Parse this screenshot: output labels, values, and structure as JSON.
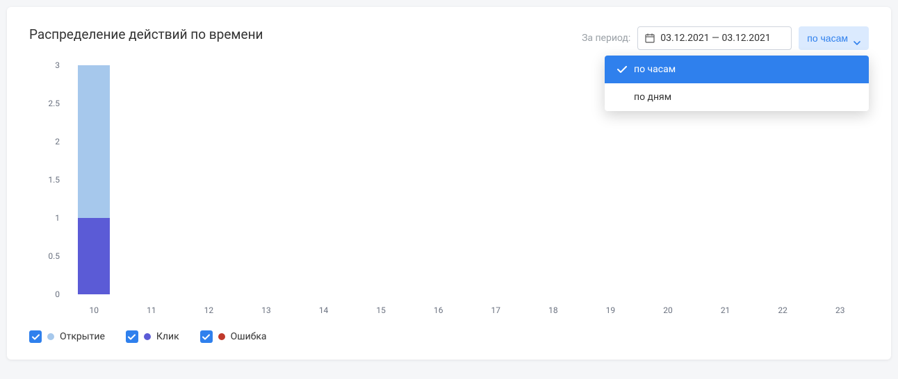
{
  "title": "Распределение действий по времени",
  "controls": {
    "period_label": "За период:",
    "date_range": "03.12.2021 — 03.12.2021",
    "granularity_label": "по часам",
    "dropdown": [
      {
        "label": "по часам",
        "selected": true
      },
      {
        "label": "по дням",
        "selected": false
      }
    ]
  },
  "legend": [
    {
      "name": "Открытие",
      "color": "#a6c8ec",
      "checked": true
    },
    {
      "name": "Клик",
      "color": "#5b5bd6",
      "checked": true
    },
    {
      "name": "Ошибка",
      "color": "#c0392b",
      "checked": true
    }
  ],
  "colors": {
    "accent": "#2f80ed",
    "accent_light": "#dbeafe"
  },
  "chart_data": {
    "type": "bar",
    "stacked": true,
    "categories": [
      "10",
      "11",
      "12",
      "13",
      "14",
      "15",
      "16",
      "17",
      "18",
      "19",
      "20",
      "21",
      "22",
      "23"
    ],
    "series": [
      {
        "name": "Клик",
        "color": "#5b5bd6",
        "values": [
          1,
          0,
          0,
          0,
          0,
          0,
          0,
          0,
          0,
          0,
          0,
          0,
          0,
          0
        ]
      },
      {
        "name": "Открытие",
        "color": "#a6c8ec",
        "values": [
          2,
          0,
          0,
          0,
          0,
          0,
          0,
          0,
          0,
          0,
          0,
          0,
          0,
          0
        ]
      },
      {
        "name": "Ошибка",
        "color": "#c0392b",
        "values": [
          0,
          0,
          0,
          0,
          0,
          0,
          0,
          0,
          0,
          0,
          0,
          0,
          0,
          0
        ]
      }
    ],
    "ylim": [
      0,
      3
    ],
    "yticks": [
      0,
      0.5,
      1.0,
      1.5,
      2.0,
      2.5,
      3.0
    ],
    "xlabel": "",
    "ylabel": "",
    "title": "Распределение действий по времени"
  }
}
